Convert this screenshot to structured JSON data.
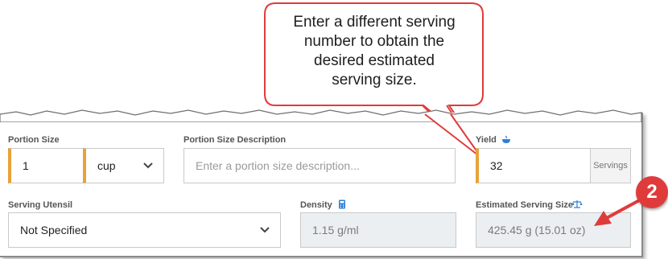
{
  "callout": {
    "lines": [
      "Enter a different serving",
      "number to obtain the",
      "desired estimated",
      "serving size."
    ]
  },
  "step_badge": "2",
  "colors": {
    "accent": "#e8a23a",
    "callout_border": "#e03b3b",
    "badge": "#e03b3b",
    "icon_blue": "#2f7fd6"
  },
  "portion_size": {
    "label": "Portion Size",
    "value": "1",
    "unit": "cup"
  },
  "portion_description": {
    "label": "Portion Size Description",
    "placeholder": "Enter a portion size description..."
  },
  "yield": {
    "label": "Yield",
    "icon": "bowl-icon",
    "value": "32",
    "unit": "Servings"
  },
  "serving_utensil": {
    "label": "Serving Utensil",
    "value": "Not Specified"
  },
  "density": {
    "label": "Density",
    "icon": "calculator-icon",
    "value": "1.15 g/ml"
  },
  "estimated_serving_size": {
    "label": "Estimated Serving Size",
    "icon": "scale-icon",
    "value": "425.45 g (15.01 oz)"
  }
}
